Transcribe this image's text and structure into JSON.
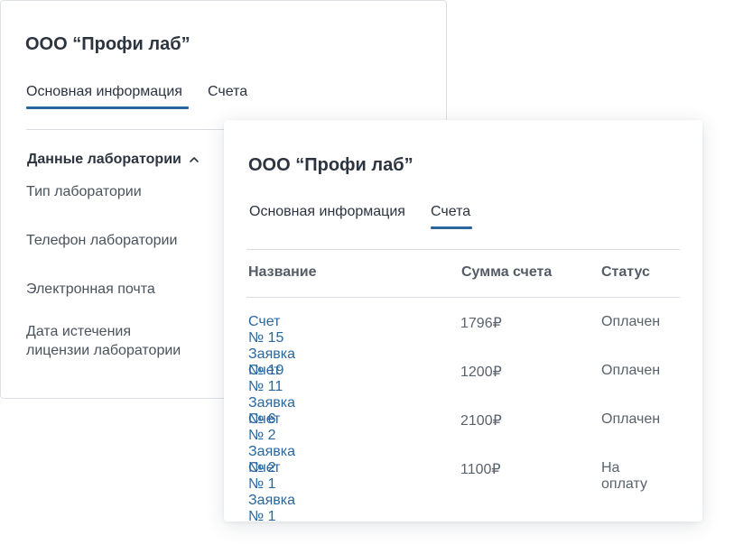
{
  "back_card": {
    "title": "ООО “Профи лаб”",
    "tabs": [
      {
        "label": "Основная информация",
        "active": true
      },
      {
        "label": "Счета",
        "active": false
      }
    ],
    "section_title": "Данные лаборатории",
    "fields": [
      {
        "label": "Тип лаборатории"
      },
      {
        "label": "Телефон лаборатории"
      },
      {
        "label": "Электронная почта"
      },
      {
        "label_line1": "Дата истечения",
        "label_line2": "лицензии лаборатории"
      }
    ]
  },
  "front_card": {
    "title": "ООО “Профи лаб”",
    "tabs": [
      {
        "label": "Основная информация",
        "active": false
      },
      {
        "label": "Счета",
        "active": true
      }
    ],
    "table": {
      "headers": {
        "name": "Название",
        "amount": "Сумма счета",
        "status": "Статус"
      },
      "rows": [
        {
          "name": "Счет № 15 Заявка  № 19",
          "amount": "1796₽",
          "status": "Оплачен"
        },
        {
          "name": "Счет № 11 Заявка  № 6",
          "amount": "1200₽",
          "status": "Оплачен"
        },
        {
          "name": "Счет № 2 Заявка  № 2",
          "amount": "2100₽",
          "status": "Оплачен"
        },
        {
          "name": "Счет № 1 Заявка  № 1",
          "amount": "1100₽",
          "status": "На оплату"
        }
      ]
    }
  },
  "colors": {
    "accent": "#2a679f",
    "text": "#2c3440",
    "muted": "#5a626b",
    "divider": "#d9dde2"
  },
  "icons": {
    "section_toggle": "chevron-up-icon"
  }
}
